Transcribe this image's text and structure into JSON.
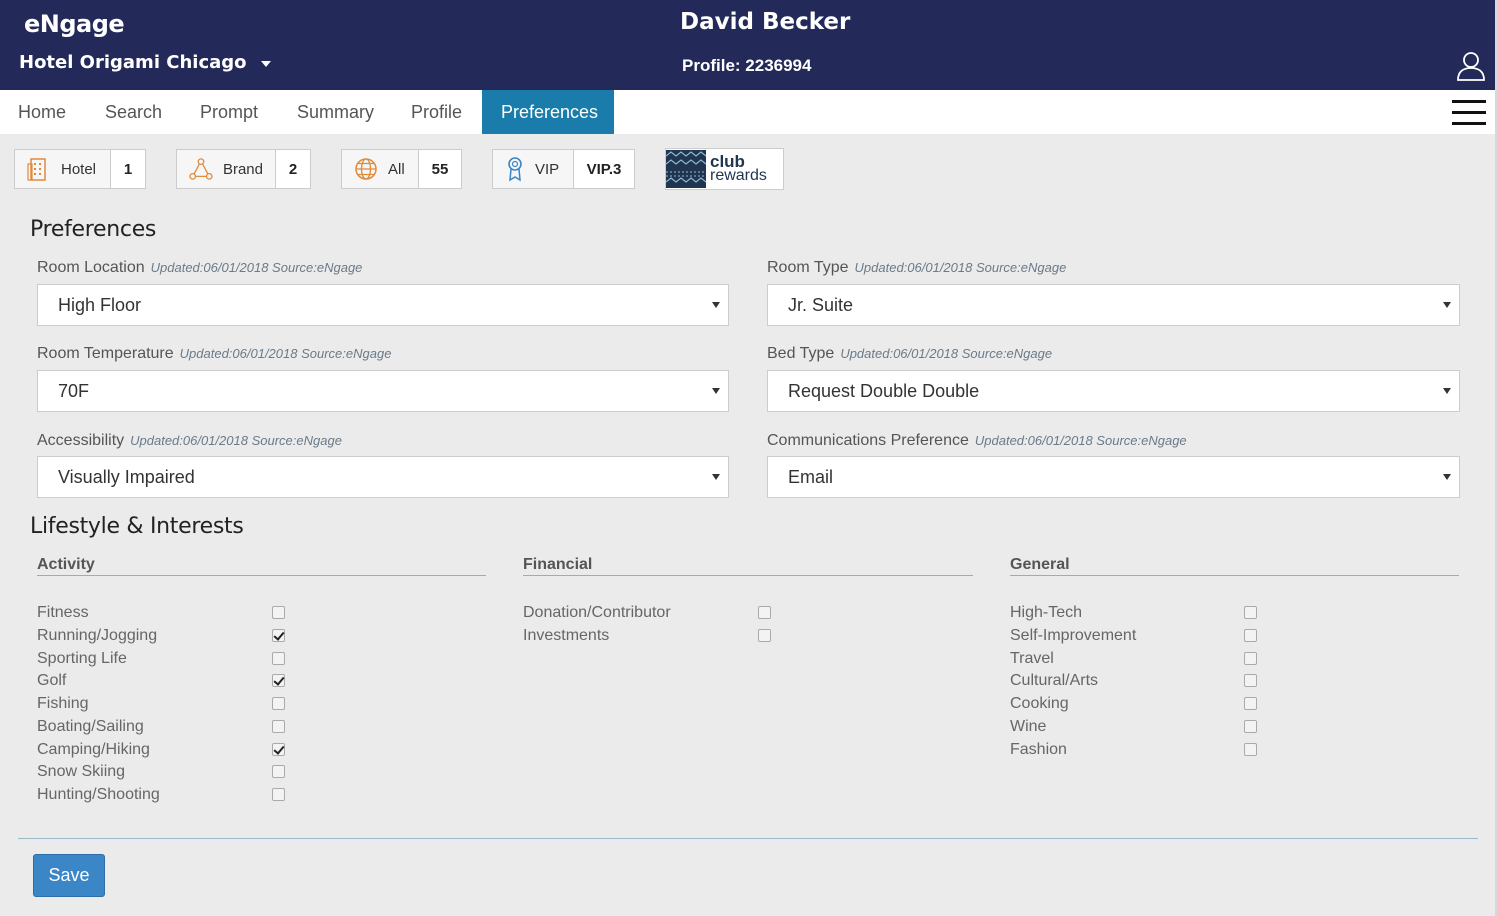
{
  "header": {
    "app_name": "eNgage",
    "hotel": "Hotel Origami Chicago",
    "guest_name": "David Becker",
    "profile": "Profile: 2236994"
  },
  "nav": {
    "items": [
      {
        "label": "Home"
      },
      {
        "label": "Search"
      },
      {
        "label": "Prompt"
      },
      {
        "label": "Summary"
      },
      {
        "label": "Profile"
      },
      {
        "label": "Preferences"
      }
    ],
    "active": "Preferences"
  },
  "counters": {
    "hotel": {
      "label": "Hotel",
      "value": "1"
    },
    "brand": {
      "label": "Brand",
      "value": "2"
    },
    "all": {
      "label": "All",
      "value": "55"
    },
    "vip": {
      "label": "VIP",
      "value": "VIP.3"
    }
  },
  "club_logo": {
    "line1": "club",
    "line2": "rewards"
  },
  "preferences": {
    "title": "Preferences",
    "fields": [
      {
        "label": "Room Location",
        "updated": "Updated:06/01/2018 Source:eNgage",
        "value": "High Floor"
      },
      {
        "label": "Room Type",
        "updated": "Updated:06/01/2018 Source:eNgage",
        "value": "Jr. Suite"
      },
      {
        "label": "Room Temperature",
        "updated": "Updated:06/01/2018 Source:eNgage",
        "value": "70F"
      },
      {
        "label": "Bed Type",
        "updated": "Updated:06/01/2018 Source:eNgage",
        "value": "Request Double Double"
      },
      {
        "label": "Accessibility",
        "updated": "Updated:06/01/2018 Source:eNgage",
        "value": "Visually Impaired"
      },
      {
        "label": "Communications Preference",
        "updated": "Updated:06/01/2018 Source:eNgage",
        "value": "Email"
      }
    ]
  },
  "lifestyle": {
    "title": "Lifestyle & Interests",
    "columns": [
      {
        "heading": "Activity",
        "items": [
          {
            "label": "Fitness",
            "checked": false
          },
          {
            "label": "Running/Jogging",
            "checked": true
          },
          {
            "label": "Sporting Life",
            "checked": false
          },
          {
            "label": "Golf",
            "checked": true
          },
          {
            "label": "Fishing",
            "checked": false
          },
          {
            "label": "Boating/Sailing",
            "checked": false
          },
          {
            "label": "Camping/Hiking",
            "checked": true
          },
          {
            "label": "Snow Skiing",
            "checked": false
          },
          {
            "label": "Hunting/Shooting",
            "checked": false
          }
        ]
      },
      {
        "heading": "Financial",
        "items": [
          {
            "label": "Donation/Contributor",
            "checked": false
          },
          {
            "label": "Investments",
            "checked": false
          }
        ]
      },
      {
        "heading": "General",
        "items": [
          {
            "label": "High-Tech",
            "checked": false
          },
          {
            "label": "Self-Improvement",
            "checked": false
          },
          {
            "label": "Travel",
            "checked": false
          },
          {
            "label": "Cultural/Arts",
            "checked": false
          },
          {
            "label": "Cooking",
            "checked": false
          },
          {
            "label": "Wine",
            "checked": false
          },
          {
            "label": "Fashion",
            "checked": false
          }
        ]
      }
    ]
  },
  "actions": {
    "save_label": "Save"
  },
  "colors": {
    "header_bg": "#232a5a",
    "active_tab": "#1a7cab",
    "save_button": "#3b86c6"
  }
}
